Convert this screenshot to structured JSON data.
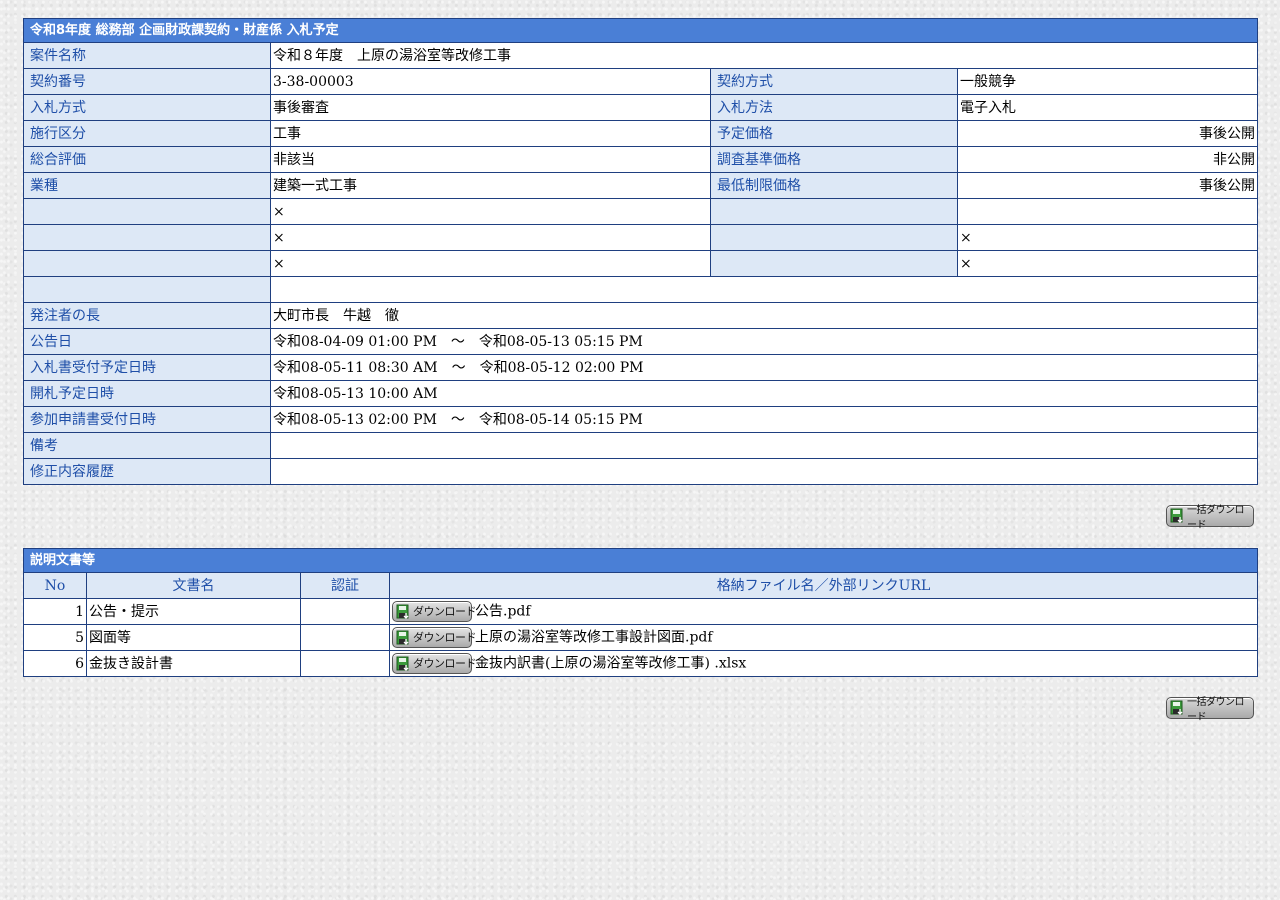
{
  "main": {
    "title": "令和8年度 総務部 企画財政課契約・財産係 入札予定",
    "rows": {
      "case_name": {
        "label": "案件名称",
        "value": "令和８年度　上原の湯浴室等改修工事"
      },
      "contract_no": {
        "label": "契約番号",
        "value": "3-38-00003",
        "label2": "契約方式",
        "value2": "一般競争"
      },
      "bid_method": {
        "label": "入札方式",
        "value": "事後審査",
        "label2": "入札方法",
        "value2": "電子入札"
      },
      "category": {
        "label": "施行区分",
        "value": "工事",
        "label2": "予定価格",
        "value2": "事後公開"
      },
      "evaluation": {
        "label": "総合評価",
        "value": "非該当",
        "label2": "調査基準価格",
        "value2": "非公開"
      },
      "industry": {
        "label": "業種",
        "value": "建築一式工事",
        "label2": "最低制限価格",
        "value2": "事後公開"
      },
      "blank1": {
        "value": "×",
        "value2": ""
      },
      "blank2": {
        "value": "×",
        "value2": "×"
      },
      "blank3": {
        "value": "×",
        "value2": "×"
      },
      "orderer": {
        "label": "発注者の長",
        "value": "大町市長　牛越　徹"
      },
      "notice_date": {
        "label": "公告日",
        "value": "令和08-04-09 01:00 PM　～　令和08-05-13 05:15 PM"
      },
      "bid_receipt": {
        "label": "入札書受付予定日時",
        "value": "令和08-05-11 08:30 AM　～　令和08-05-12 02:00 PM"
      },
      "opening": {
        "label": "開札予定日時",
        "value": "令和08-05-13 10:00 AM"
      },
      "application": {
        "label": "参加申請書受付日時",
        "value": "令和08-05-13 02:00 PM　～　令和08-05-14 05:15 PM"
      },
      "remarks": {
        "label": "備考",
        "value": ""
      },
      "revision": {
        "label": "修正内容履歴",
        "value": ""
      }
    }
  },
  "download_all_label": "一括ダウンロード",
  "docs": {
    "title": "説明文書等",
    "headers": {
      "no": "No",
      "name": "文書名",
      "cert": "認証",
      "file": "格納ファイル名／外部リンクURL"
    },
    "download_label": "ダウンロード",
    "items": [
      {
        "no": "1",
        "name": "公告・提示",
        "cert": "",
        "file": "公告.pdf"
      },
      {
        "no": "5",
        "name": "図面等",
        "cert": "",
        "file": "上原の湯浴室等改修工事設計図面.pdf"
      },
      {
        "no": "6",
        "name": "金抜き設計書",
        "cert": "",
        "file": "金抜内訳書(上原の湯浴室等改修工事) .xlsx"
      }
    ]
  },
  "colors": {
    "header_bg": "#4a7fd6",
    "label_bg": "#dde8f6",
    "label_text": "#1f4fa8",
    "border": "#1f3f80"
  },
  "icons": {
    "download": "floppy-disk-green-arrow-icon"
  }
}
